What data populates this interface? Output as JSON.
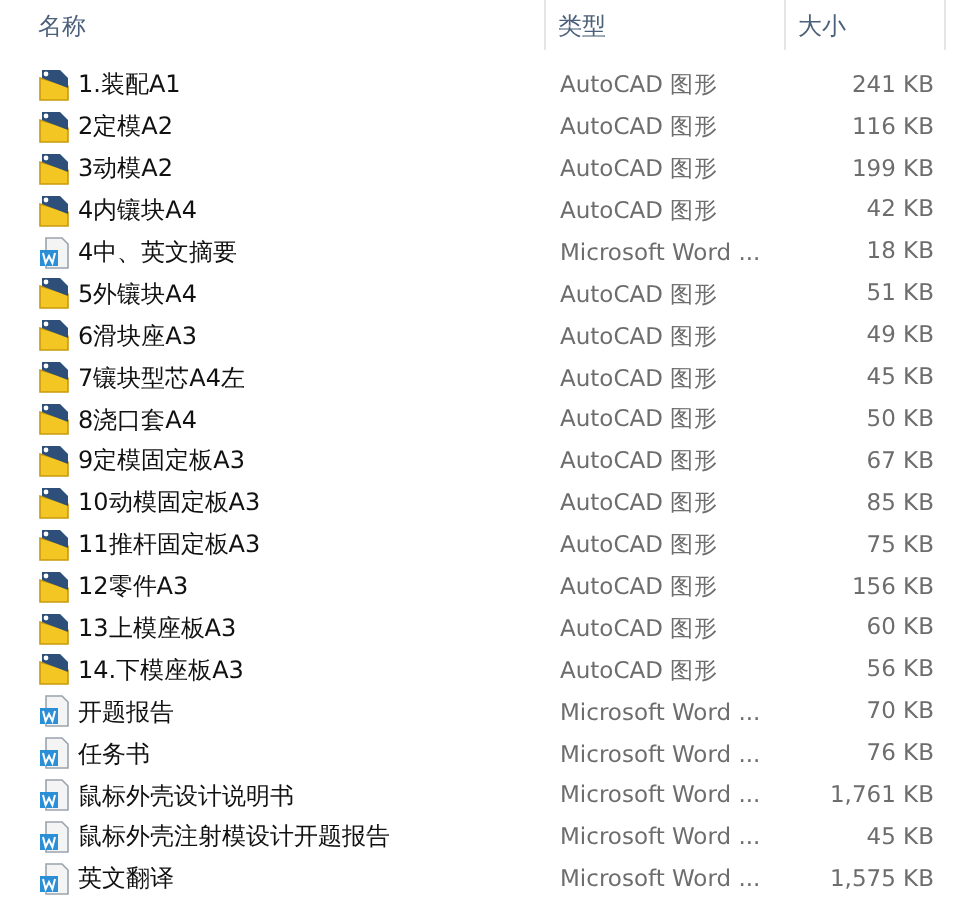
{
  "columns": [
    {
      "label": "名称"
    },
    {
      "label": "类型"
    },
    {
      "label": "大小"
    }
  ],
  "files": [
    {
      "name": "1.装配A1",
      "kind": "dwg",
      "type": "AutoCAD 图形",
      "size": "241 KB"
    },
    {
      "name": "2定模A2",
      "kind": "dwg",
      "type": "AutoCAD 图形",
      "size": "116 KB"
    },
    {
      "name": "3动模A2",
      "kind": "dwg",
      "type": "AutoCAD 图形",
      "size": "199 KB"
    },
    {
      "name": "4内镶块A4",
      "kind": "dwg",
      "type": "AutoCAD 图形",
      "size": "42 KB"
    },
    {
      "name": "4中、英文摘要",
      "kind": "doc",
      "type": "Microsoft Word ...",
      "size": "18 KB"
    },
    {
      "name": "5外镶块A4",
      "kind": "dwg",
      "type": "AutoCAD 图形",
      "size": "51 KB"
    },
    {
      "name": "6滑块座A3",
      "kind": "dwg",
      "type": "AutoCAD 图形",
      "size": "49 KB"
    },
    {
      "name": "7镶块型芯A4左",
      "kind": "dwg",
      "type": "AutoCAD 图形",
      "size": "45 KB"
    },
    {
      "name": "8浇口套A4",
      "kind": "dwg",
      "type": "AutoCAD 图形",
      "size": "50 KB"
    },
    {
      "name": "9定模固定板A3",
      "kind": "dwg",
      "type": "AutoCAD 图形",
      "size": "67 KB"
    },
    {
      "name": "10动模固定板A3",
      "kind": "dwg",
      "type": "AutoCAD 图形",
      "size": "85 KB"
    },
    {
      "name": "11推杆固定板A3",
      "kind": "dwg",
      "type": "AutoCAD 图形",
      "size": "75 KB"
    },
    {
      "name": "12零件A3",
      "kind": "dwg",
      "type": "AutoCAD 图形",
      "size": "156 KB"
    },
    {
      "name": "13上模座板A3",
      "kind": "dwg",
      "type": "AutoCAD 图形",
      "size": "60 KB"
    },
    {
      "name": "14.下模座板A3",
      "kind": "dwg",
      "type": "AutoCAD 图形",
      "size": "56 KB"
    },
    {
      "name": "开题报告",
      "kind": "doc",
      "type": "Microsoft Word ...",
      "size": "70 KB"
    },
    {
      "name": "任务书",
      "kind": "doc",
      "type": "Microsoft Word ...",
      "size": "76 KB"
    },
    {
      "name": "鼠标外壳设计说明书",
      "kind": "doc",
      "type": "Microsoft Word ...",
      "size": "1,761 KB"
    },
    {
      "name": "鼠标外壳注射模设计开题报告",
      "kind": "doc",
      "type": "Microsoft Word ...",
      "size": "45 KB"
    },
    {
      "name": "英文翻译",
      "kind": "doc",
      "type": "Microsoft Word ...",
      "size": "1,575 KB"
    }
  ]
}
